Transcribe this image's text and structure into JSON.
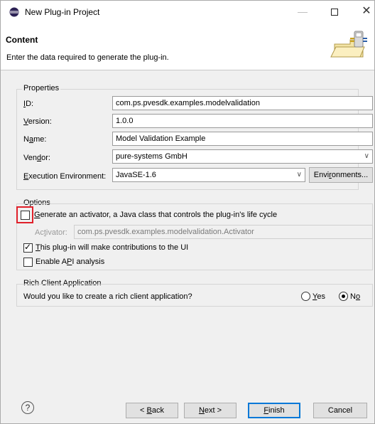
{
  "window": {
    "title": "New Plug-in Project",
    "close_glyph": "✕",
    "minimize_glyph": "—"
  },
  "header": {
    "title": "Content",
    "description": "Enter the data required to generate the plug-in."
  },
  "properties": {
    "group_label": "Properties",
    "id": {
      "label_u": "I",
      "label_rest": "D:",
      "value": "com.ps.pvesdk.examples.modelvalidation"
    },
    "version": {
      "label_u": "V",
      "label_rest": "ersion:",
      "value": "1.0.0"
    },
    "name": {
      "label_pre": "N",
      "label_u": "a",
      "label_rest": "me:",
      "value": "Model Validation Example"
    },
    "vendor": {
      "label_pre": "Ven",
      "label_u": "d",
      "label_rest": "or:",
      "value": "pure-systems GmbH"
    },
    "environment": {
      "label_u": "E",
      "label_rest": "xecution Environment:",
      "value": "JavaSE-1.6",
      "button_pre": "Envi",
      "button_u": "r",
      "button_rest": "onments..."
    }
  },
  "options": {
    "group_label": "Options",
    "generate_activator": {
      "label_u": "G",
      "label_rest": "enerate an activator, a Java class that controls the plug-in's life cycle",
      "checked": false
    },
    "activator": {
      "label_pre": "Ac",
      "label_u": "t",
      "label_rest": "ivator:",
      "value": "com.ps.pvesdk.examples.modelvalidation.Activator"
    },
    "contributions": {
      "label_u": "T",
      "label_rest": "his plug-in will make contributions to the UI",
      "checked": true
    },
    "api_analysis": {
      "label_pre": "Enable A",
      "label_u": "P",
      "label_rest": "I analysis",
      "checked": false
    }
  },
  "rcp": {
    "group_label": "Rich Client Application",
    "question": "Would you like to create a rich client application?",
    "yes": {
      "label_u": "Y",
      "label_rest": "es",
      "selected": false
    },
    "no": {
      "label_pre": "N",
      "label_u": "o",
      "label_rest": "",
      "selected": true
    }
  },
  "footer": {
    "help": "?",
    "back": {
      "pre": "< ",
      "u": "B",
      "rest": "ack"
    },
    "next": {
      "pre": "",
      "u": "N",
      "rest": "ext >"
    },
    "finish": {
      "pre": "",
      "u": "F",
      "rest": "inish"
    },
    "cancel": "Cancel"
  },
  "colors": {
    "highlight": "#e0202a",
    "default_button_border": "#0078d7"
  },
  "icons": {
    "window": "eclipse-icon",
    "header": "plug-in-wizard-icon",
    "combo": "chevron-down-icon",
    "help": "help-icon"
  }
}
